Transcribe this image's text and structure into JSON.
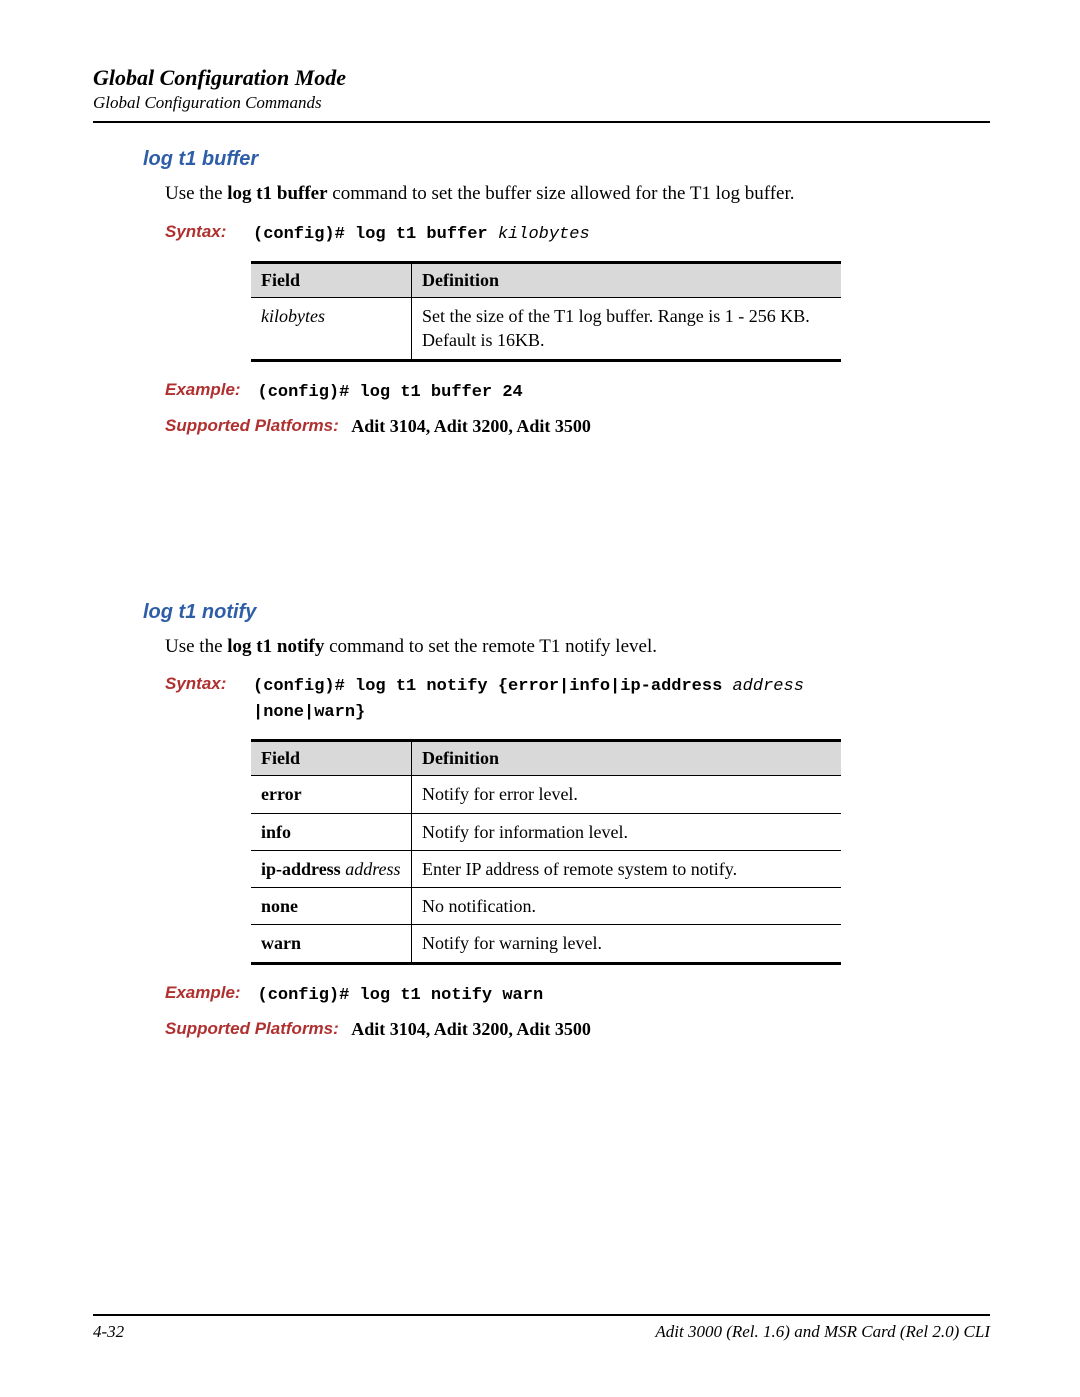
{
  "header": {
    "title": "Global Configuration Mode",
    "subtitle": "Global Configuration Commands"
  },
  "sections": [
    {
      "id": "log-t1-buffer",
      "title": "log t1 buffer",
      "desc_prefix": "Use the ",
      "desc_cmd": "log t1 buffer",
      "desc_suffix": " command to set the buffer size allowed for the T1 log buffer.",
      "syntax_label": "Syntax:",
      "syntax_prefix": "(config)# log t1 buffer ",
      "syntax_param": "kilobytes",
      "syntax_line2": "",
      "table": {
        "headers": [
          "Field",
          "Definition"
        ],
        "rows": [
          {
            "field_italic": "kilobytes",
            "field_bold": "",
            "field_italic_suffix": "",
            "def": "Set the size of  the T1 log buffer. Range is 1 - 256 KB.   Default is 16KB."
          }
        ]
      },
      "example_label": "Example:",
      "example_text": "(config)# log t1 buffer 24",
      "platforms_label": "Supported Platforms:",
      "platforms_value": "Adit 3104, Adit 3200, Adit 3500"
    },
    {
      "id": "log-t1-notify",
      "title": "log t1 notify",
      "desc_prefix": "Use the ",
      "desc_cmd": "log t1 notify",
      "desc_suffix": " command to set the remote T1 notify level.",
      "syntax_label": "Syntax:",
      "syntax_prefix": "(config)# log t1 notify {error|info|ip-address ",
      "syntax_param": "address",
      "syntax_line2": "|none|warn}",
      "table": {
        "headers": [
          "Field",
          "Definition"
        ],
        "rows": [
          {
            "field_italic": "",
            "field_bold": "error",
            "field_italic_suffix": "",
            "def": "Notify for error level."
          },
          {
            "field_italic": "",
            "field_bold": "info",
            "field_italic_suffix": "",
            "def": "Notify for information level."
          },
          {
            "field_italic": "",
            "field_bold": "ip-address ",
            "field_italic_suffix": "address",
            "def": "Enter IP address of remote system to notify."
          },
          {
            "field_italic": "",
            "field_bold": "none",
            "field_italic_suffix": "",
            "def": "No notification."
          },
          {
            "field_italic": "",
            "field_bold": "warn",
            "field_italic_suffix": "",
            "def": "Notify for warning level."
          }
        ]
      },
      "example_label": "Example:",
      "example_text": "(config)# log t1 notify warn",
      "platforms_label": "Supported Platforms:",
      "platforms_value": "Adit 3104, Adit 3200, Adit 3500"
    }
  ],
  "footer": {
    "page": "4-32",
    "doc": "Adit 3000 (Rel. 1.6) and MSR Card (Rel 2.0) CLI"
  }
}
